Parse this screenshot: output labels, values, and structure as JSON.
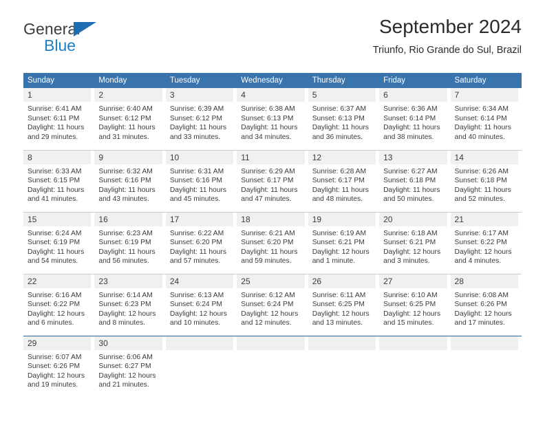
{
  "brand": {
    "line1": "General",
    "line2": "Blue",
    "flag_color": "#1f6cb0"
  },
  "header": {
    "title": "September 2024",
    "subtitle": "Triunfo, Rio Grande do Sul, Brazil"
  },
  "theme": {
    "header_blue": "#3a74ad",
    "daynum_gray": "#f0f0f0",
    "row_divider": "#cccccc",
    "last_row_divider": "#27609e"
  },
  "labels": {
    "sunrise_prefix": "Sunrise:",
    "sunset_prefix": "Sunset:",
    "daylight_prefix": "Daylight:"
  },
  "weekdays": [
    "Sunday",
    "Monday",
    "Tuesday",
    "Wednesday",
    "Thursday",
    "Friday",
    "Saturday"
  ],
  "weeks": [
    [
      {
        "day": "1",
        "sunrise": "Sunrise: 6:41 AM",
        "sunset": "Sunset: 6:11 PM",
        "daylight_l1": "Daylight: 11 hours",
        "daylight_l2": "and 29 minutes."
      },
      {
        "day": "2",
        "sunrise": "Sunrise: 6:40 AM",
        "sunset": "Sunset: 6:12 PM",
        "daylight_l1": "Daylight: 11 hours",
        "daylight_l2": "and 31 minutes."
      },
      {
        "day": "3",
        "sunrise": "Sunrise: 6:39 AM",
        "sunset": "Sunset: 6:12 PM",
        "daylight_l1": "Daylight: 11 hours",
        "daylight_l2": "and 33 minutes."
      },
      {
        "day": "4",
        "sunrise": "Sunrise: 6:38 AM",
        "sunset": "Sunset: 6:13 PM",
        "daylight_l1": "Daylight: 11 hours",
        "daylight_l2": "and 34 minutes."
      },
      {
        "day": "5",
        "sunrise": "Sunrise: 6:37 AM",
        "sunset": "Sunset: 6:13 PM",
        "daylight_l1": "Daylight: 11 hours",
        "daylight_l2": "and 36 minutes."
      },
      {
        "day": "6",
        "sunrise": "Sunrise: 6:36 AM",
        "sunset": "Sunset: 6:14 PM",
        "daylight_l1": "Daylight: 11 hours",
        "daylight_l2": "and 38 minutes."
      },
      {
        "day": "7",
        "sunrise": "Sunrise: 6:34 AM",
        "sunset": "Sunset: 6:14 PM",
        "daylight_l1": "Daylight: 11 hours",
        "daylight_l2": "and 40 minutes."
      }
    ],
    [
      {
        "day": "8",
        "sunrise": "Sunrise: 6:33 AM",
        "sunset": "Sunset: 6:15 PM",
        "daylight_l1": "Daylight: 11 hours",
        "daylight_l2": "and 41 minutes."
      },
      {
        "day": "9",
        "sunrise": "Sunrise: 6:32 AM",
        "sunset": "Sunset: 6:16 PM",
        "daylight_l1": "Daylight: 11 hours",
        "daylight_l2": "and 43 minutes."
      },
      {
        "day": "10",
        "sunrise": "Sunrise: 6:31 AM",
        "sunset": "Sunset: 6:16 PM",
        "daylight_l1": "Daylight: 11 hours",
        "daylight_l2": "and 45 minutes."
      },
      {
        "day": "11",
        "sunrise": "Sunrise: 6:29 AM",
        "sunset": "Sunset: 6:17 PM",
        "daylight_l1": "Daylight: 11 hours",
        "daylight_l2": "and 47 minutes."
      },
      {
        "day": "12",
        "sunrise": "Sunrise: 6:28 AM",
        "sunset": "Sunset: 6:17 PM",
        "daylight_l1": "Daylight: 11 hours",
        "daylight_l2": "and 48 minutes."
      },
      {
        "day": "13",
        "sunrise": "Sunrise: 6:27 AM",
        "sunset": "Sunset: 6:18 PM",
        "daylight_l1": "Daylight: 11 hours",
        "daylight_l2": "and 50 minutes."
      },
      {
        "day": "14",
        "sunrise": "Sunrise: 6:26 AM",
        "sunset": "Sunset: 6:18 PM",
        "daylight_l1": "Daylight: 11 hours",
        "daylight_l2": "and 52 minutes."
      }
    ],
    [
      {
        "day": "15",
        "sunrise": "Sunrise: 6:24 AM",
        "sunset": "Sunset: 6:19 PM",
        "daylight_l1": "Daylight: 11 hours",
        "daylight_l2": "and 54 minutes."
      },
      {
        "day": "16",
        "sunrise": "Sunrise: 6:23 AM",
        "sunset": "Sunset: 6:19 PM",
        "daylight_l1": "Daylight: 11 hours",
        "daylight_l2": "and 56 minutes."
      },
      {
        "day": "17",
        "sunrise": "Sunrise: 6:22 AM",
        "sunset": "Sunset: 6:20 PM",
        "daylight_l1": "Daylight: 11 hours",
        "daylight_l2": "and 57 minutes."
      },
      {
        "day": "18",
        "sunrise": "Sunrise: 6:21 AM",
        "sunset": "Sunset: 6:20 PM",
        "daylight_l1": "Daylight: 11 hours",
        "daylight_l2": "and 59 minutes."
      },
      {
        "day": "19",
        "sunrise": "Sunrise: 6:19 AM",
        "sunset": "Sunset: 6:21 PM",
        "daylight_l1": "Daylight: 12 hours",
        "daylight_l2": "and 1 minute."
      },
      {
        "day": "20",
        "sunrise": "Sunrise: 6:18 AM",
        "sunset": "Sunset: 6:21 PM",
        "daylight_l1": "Daylight: 12 hours",
        "daylight_l2": "and 3 minutes."
      },
      {
        "day": "21",
        "sunrise": "Sunrise: 6:17 AM",
        "sunset": "Sunset: 6:22 PM",
        "daylight_l1": "Daylight: 12 hours",
        "daylight_l2": "and 4 minutes."
      }
    ],
    [
      {
        "day": "22",
        "sunrise": "Sunrise: 6:16 AM",
        "sunset": "Sunset: 6:22 PM",
        "daylight_l1": "Daylight: 12 hours",
        "daylight_l2": "and 6 minutes."
      },
      {
        "day": "23",
        "sunrise": "Sunrise: 6:14 AM",
        "sunset": "Sunset: 6:23 PM",
        "daylight_l1": "Daylight: 12 hours",
        "daylight_l2": "and 8 minutes."
      },
      {
        "day": "24",
        "sunrise": "Sunrise: 6:13 AM",
        "sunset": "Sunset: 6:24 PM",
        "daylight_l1": "Daylight: 12 hours",
        "daylight_l2": "and 10 minutes."
      },
      {
        "day": "25",
        "sunrise": "Sunrise: 6:12 AM",
        "sunset": "Sunset: 6:24 PM",
        "daylight_l1": "Daylight: 12 hours",
        "daylight_l2": "and 12 minutes."
      },
      {
        "day": "26",
        "sunrise": "Sunrise: 6:11 AM",
        "sunset": "Sunset: 6:25 PM",
        "daylight_l1": "Daylight: 12 hours",
        "daylight_l2": "and 13 minutes."
      },
      {
        "day": "27",
        "sunrise": "Sunrise: 6:10 AM",
        "sunset": "Sunset: 6:25 PM",
        "daylight_l1": "Daylight: 12 hours",
        "daylight_l2": "and 15 minutes."
      },
      {
        "day": "28",
        "sunrise": "Sunrise: 6:08 AM",
        "sunset": "Sunset: 6:26 PM",
        "daylight_l1": "Daylight: 12 hours",
        "daylight_l2": "and 17 minutes."
      }
    ],
    [
      {
        "day": "29",
        "sunrise": "Sunrise: 6:07 AM",
        "sunset": "Sunset: 6:26 PM",
        "daylight_l1": "Daylight: 12 hours",
        "daylight_l2": "and 19 minutes."
      },
      {
        "day": "30",
        "sunrise": "Sunrise: 6:06 AM",
        "sunset": "Sunset: 6:27 PM",
        "daylight_l1": "Daylight: 12 hours",
        "daylight_l2": "and 21 minutes."
      },
      {
        "day": "",
        "sunrise": "",
        "sunset": "",
        "daylight_l1": "",
        "daylight_l2": ""
      },
      {
        "day": "",
        "sunrise": "",
        "sunset": "",
        "daylight_l1": "",
        "daylight_l2": ""
      },
      {
        "day": "",
        "sunrise": "",
        "sunset": "",
        "daylight_l1": "",
        "daylight_l2": ""
      },
      {
        "day": "",
        "sunrise": "",
        "sunset": "",
        "daylight_l1": "",
        "daylight_l2": ""
      },
      {
        "day": "",
        "sunrise": "",
        "sunset": "",
        "daylight_l1": "",
        "daylight_l2": ""
      }
    ]
  ]
}
